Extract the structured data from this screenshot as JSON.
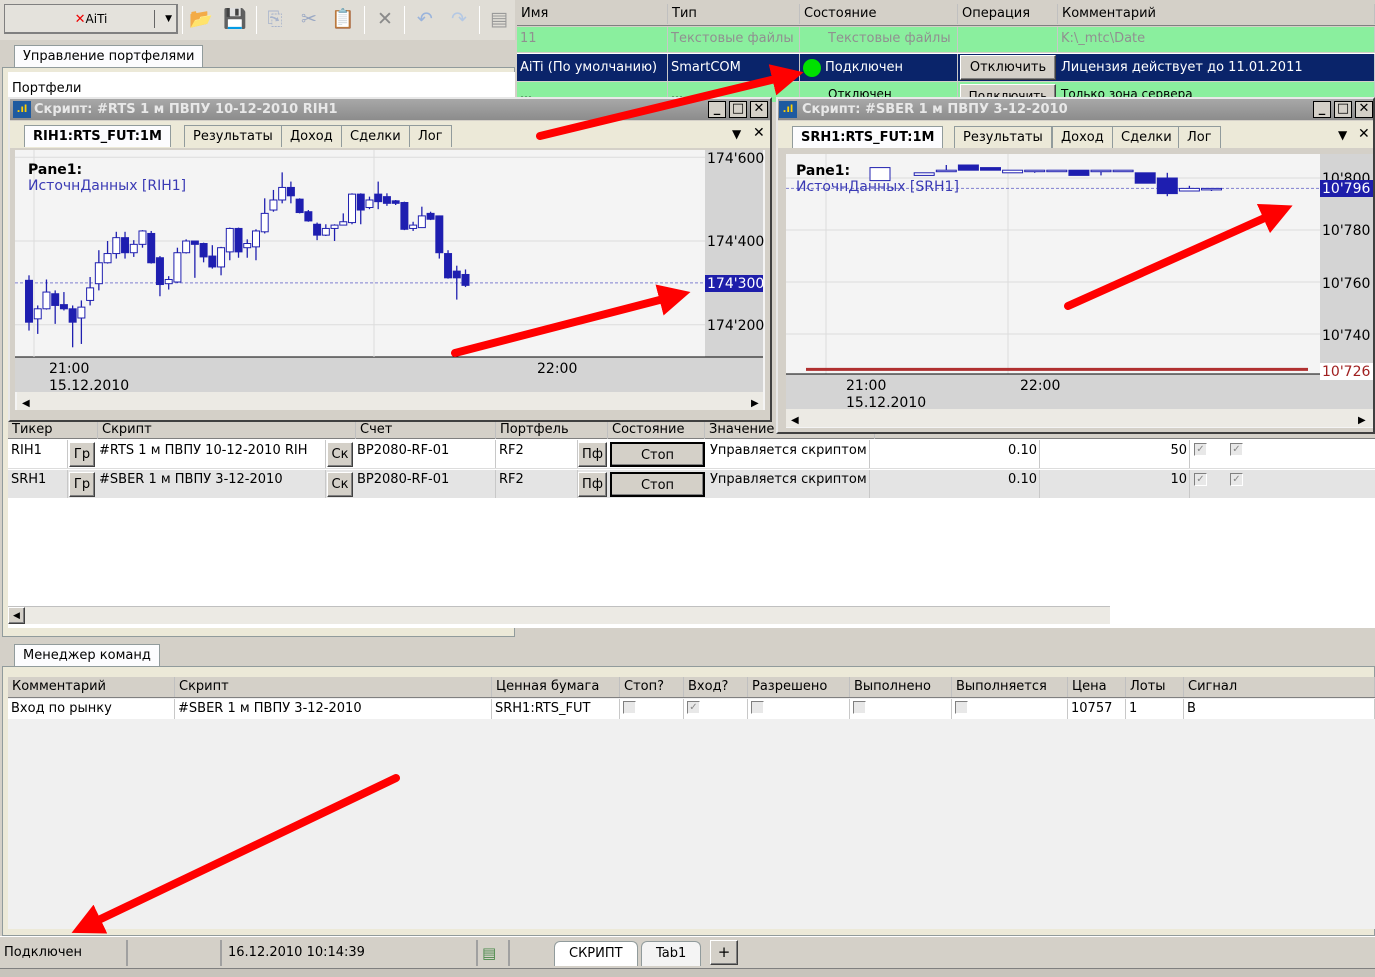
{
  "toolbar": {
    "app_button": "AiTi",
    "icons": [
      "open-folder-icon",
      "save-icon",
      "copy-icon",
      "cut-icon",
      "paste-icon",
      "delete-icon",
      "undo-icon",
      "redo-icon",
      "document-icon"
    ]
  },
  "portfolio_panel": {
    "tab": "Управление портфелями",
    "label": "Портфели"
  },
  "connections": {
    "columns": [
      "Имя",
      "Тип",
      "Состояние",
      "Операция",
      "Комментарий"
    ],
    "rows": [
      {
        "name": "11",
        "type": "Текстовые файлы",
        "state": "Текстовые файлы",
        "operation": "",
        "comment": "K:\\_mtc\\Date"
      },
      {
        "name": "AiTi (По умолчанию)",
        "type": "SmartCOM",
        "state": "Подключен",
        "operation": "Отключить",
        "comment": "Лицензия действует до 11.01.2011"
      },
      {
        "name": "…",
        "type": "…",
        "state": "Отключен",
        "operation": "Подключить",
        "comment": "Только зона сервера"
      }
    ],
    "colors": {
      "green": "#8aef9e",
      "selected": "#0a246a",
      "status_ok": "#00e000"
    }
  },
  "rts_window": {
    "title": "Скрипт: #RTS 1 м ПВПУ 10-12-2010 RIH1",
    "tabs": [
      "RIH1:RTS_FUT:1M",
      "Результаты",
      "Доход",
      "Сделки",
      "Лог"
    ],
    "pane": "Pane1:",
    "source": "ИсточнДанных [RIH1]"
  },
  "sber_window": {
    "title": "Скрипт: #SBER 1 м ПВПУ 3-12-2010",
    "tabs": [
      "SRH1:RTS_FUT:1M",
      "Результаты",
      "Доход",
      "Сделки",
      "Лог"
    ],
    "pane": "Pane1:",
    "source": "ИсточнДанных [SRH1]"
  },
  "chart_data": [
    {
      "type": "candlestick",
      "series": "RIH1",
      "y_ticks": [
        "174'600",
        "174'400",
        "174'200"
      ],
      "y_tick_values": [
        174600,
        174400,
        174200
      ],
      "current_label": "174'300",
      "current_value": 174300,
      "x_ticks": [
        "21:00",
        "22:00"
      ],
      "x_date": "15.12.2010",
      "ylim": [
        174105,
        174617
      ],
      "ohlc": [
        [
          174306,
          174318,
          174186,
          174206
        ],
        [
          174214,
          174246,
          174178,
          174238
        ],
        [
          174238,
          174308,
          174236,
          174278
        ],
        [
          174274,
          174282,
          174202,
          174246
        ],
        [
          174248,
          174278,
          174234,
          174238
        ],
        [
          174238,
          174246,
          174146,
          174206
        ],
        [
          174216,
          174258,
          174154,
          174242
        ],
        [
          174258,
          174314,
          174246,
          174288
        ],
        [
          174298,
          174378,
          174282,
          174348
        ],
        [
          174348,
          174400,
          174346,
          174370
        ],
        [
          174370,
          174422,
          174358,
          174408
        ],
        [
          174408,
          174422,
          174358,
          174372
        ],
        [
          174372,
          174402,
          174362,
          174392
        ],
        [
          174392,
          174426,
          174384,
          174424
        ],
        [
          174418,
          174424,
          174346,
          174348
        ],
        [
          174360,
          174364,
          174268,
          174296
        ],
        [
          174298,
          174316,
          174284,
          174308
        ],
        [
          174302,
          174384,
          174300,
          174372
        ],
        [
          174372,
          174404,
          174370,
          174400
        ],
        [
          174400,
          174400,
          174312,
          174392
        ],
        [
          174394,
          174396,
          174349,
          174362
        ],
        [
          174364,
          174390,
          174334,
          174338
        ],
        [
          174338,
          174386,
          174318,
          174384
        ],
        [
          174374,
          174432,
          174354,
          174430
        ],
        [
          174430,
          174432,
          174360,
          174374
        ],
        [
          174384,
          174404,
          174360,
          174394
        ],
        [
          174386,
          174428,
          174354,
          174424
        ],
        [
          174422,
          174502,
          174418,
          174466
        ],
        [
          174474,
          174522,
          174470,
          174498
        ],
        [
          174498,
          174564,
          174490,
          174528
        ],
        [
          174528,
          174542,
          174490,
          174508
        ],
        [
          174500,
          174502,
          174466,
          174468
        ],
        [
          174470,
          174474,
          174446,
          174448
        ],
        [
          174440,
          174444,
          174402,
          174414
        ],
        [
          174414,
          174440,
          174412,
          174430
        ],
        [
          174430,
          174440,
          174400,
          174438
        ],
        [
          174438,
          174466,
          174438,
          174446
        ],
        [
          174444,
          174514,
          174440,
          174512
        ],
        [
          174512,
          174514,
          174440,
          174474
        ],
        [
          174480,
          174506,
          174476,
          174498
        ],
        [
          174512,
          174542,
          174476,
          174494
        ],
        [
          174506,
          174514,
          174484,
          174490
        ],
        [
          174496,
          174498,
          174486,
          174490
        ],
        [
          174492,
          174494,
          174426,
          174428
        ],
        [
          174430,
          174446,
          174424,
          174438
        ],
        [
          174432,
          174482,
          174431,
          174460
        ],
        [
          174466,
          174470,
          174450,
          174452
        ],
        [
          174460,
          174461,
          174358,
          174372
        ],
        [
          174370,
          174378,
          174310,
          174312
        ],
        [
          174328,
          174341,
          174260,
          174312
        ],
        [
          174320,
          174332,
          174290,
          174294
        ]
      ]
    },
    {
      "type": "candlestick",
      "series": "SRH1",
      "y_ticks": [
        "10'800",
        "10'780",
        "10'760",
        "10'740"
      ],
      "y_tick_values": [
        10800,
        10780,
        10760,
        10740
      ],
      "current_label": "10'796",
      "current_value": 10796,
      "stop_label": "10'726",
      "stop_value": 10726,
      "x_ticks": [
        "21:00",
        "22:00"
      ],
      "x_date": "15.12.2010",
      "ylim": [
        10724,
        10811
      ],
      "ohlc": [
        [
          10799,
          10804,
          10799,
          10804
        ],
        null,
        [
          10801,
          10802,
          10801,
          10802
        ],
        [
          10803,
          10805,
          10803,
          10803
        ],
        [
          10805,
          10805,
          10803,
          10803
        ],
        [
          10804,
          10804,
          10803,
          10803
        ],
        [
          10802,
          10803,
          10802,
          10803
        ],
        [
          10803,
          10803,
          10802,
          10803
        ],
        [
          10803,
          10803,
          10803,
          10803
        ],
        [
          10803,
          10803,
          10801,
          10801
        ],
        [
          10803,
          10803,
          10801,
          10803
        ],
        [
          10803,
          10803,
          10803,
          10803
        ],
        [
          10802,
          10802,
          10798,
          10798
        ],
        [
          10800,
          10802,
          10793,
          10794
        ],
        [
          10795,
          10797,
          10795,
          10796
        ],
        [
          10796,
          10796,
          10795,
          10796
        ]
      ]
    }
  ],
  "strategies": {
    "columns": [
      "Тикер",
      "Скрипт",
      "Счет",
      "Портфель",
      "Состояние",
      "Значение"
    ],
    "rows": [
      {
        "ticker": "RIH1",
        "chart_btn": "Гр",
        "script": "#RTS 1 м ПВПУ 10-12-2010 RIH",
        "script_btn": "Ск",
        "account": "BP2080-RF-01",
        "portfolio": "RF2",
        "portfolio_btn": "Пф",
        "state_btn": "Стоп",
        "value": "Управляется скриптом",
        "num": "0.10",
        "qty": "50"
      },
      {
        "ticker": "SRH1",
        "chart_btn": "Гр",
        "script": "#SBER 1 м ПВПУ 3-12-2010",
        "script_btn": "Ск",
        "account": "BP2080-RF-01",
        "portfolio": "RF2",
        "portfolio_btn": "Пф",
        "state_btn": "Стоп",
        "value": "Управляется скриптом",
        "num": "0.10",
        "qty": "10"
      }
    ]
  },
  "commands": {
    "tab": "Менеджер команд",
    "columns": [
      "Комментарий",
      "Скрипт",
      "Ценная бумага",
      "Стоп?",
      "Вход?",
      "Разрешено",
      "Выполнено",
      "Выполняется",
      "Цена",
      "Лоты",
      "Сигнал"
    ],
    "rows": [
      {
        "comment": "Вход по рынку",
        "script": "#SBER 1 м ПВПУ 3-12-2010",
        "security": "SRH1:RTS_FUT",
        "stop": false,
        "entry": true,
        "allowed": false,
        "done": false,
        "running": false,
        "price": "10757",
        "lots": "1",
        "signal": "B"
      }
    ]
  },
  "statusbar": {
    "status": "Подключен",
    "datetime": "16.12.2010 10:14:39",
    "tabs": [
      "СКРИПТ",
      "Tab1"
    ],
    "add_tab": "+"
  }
}
